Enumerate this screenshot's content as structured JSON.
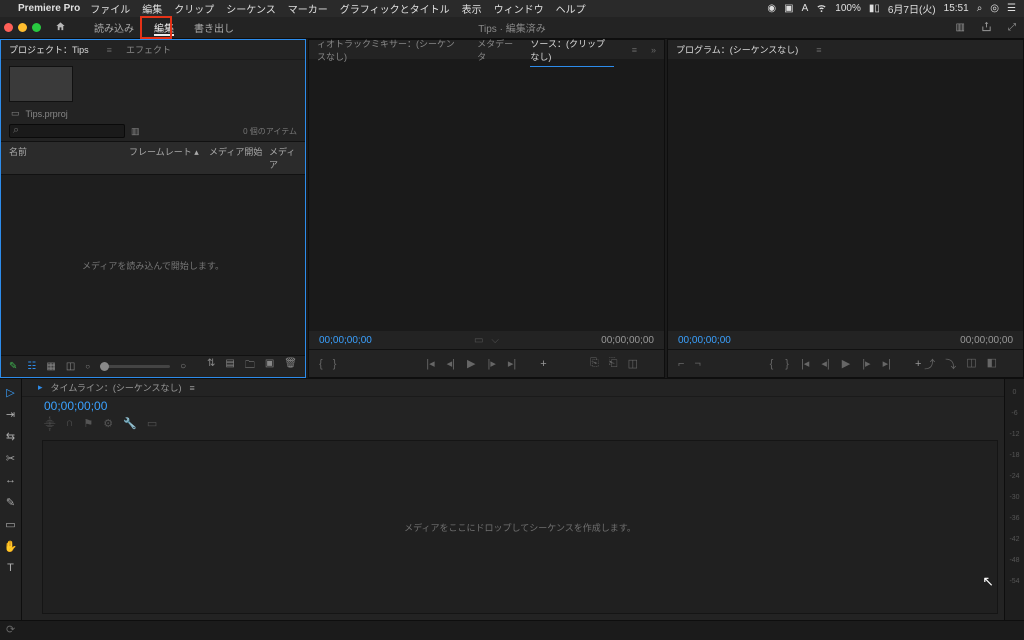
{
  "mac_menu": {
    "app": "Premiere Pro",
    "items": [
      "ファイル",
      "編集",
      "クリップ",
      "シーケンス",
      "マーカー",
      "グラフィックとタイトル",
      "表示",
      "ウィンドウ",
      "ヘルプ"
    ],
    "right": {
      "battery": "100%",
      "date": "6月7日(火)",
      "time": "15:51"
    }
  },
  "app_header": {
    "tabs": [
      "読み込み",
      "編集",
      "書き出し"
    ],
    "active_tab_index": 1,
    "title": "Tips · 編集済み"
  },
  "project_panel": {
    "tabs": [
      "プロジェクト：Tips",
      "エフェクト"
    ],
    "file": "Tips.prproj",
    "item_count": "0 個のアイテム",
    "columns": [
      "名前",
      "フレームレート ▴",
      "メディア開始",
      "メディア"
    ],
    "empty_msg": "メディアを読み込んで開始します。"
  },
  "source_panel": {
    "tabs_left": "ィオトラックミキサー：(シーケンスなし)",
    "tabs_mid": "メタデータ",
    "tabs_right": "ソース：(クリップなし)",
    "tc_left": "00;00;00;00",
    "tc_right": "00;00;00;00"
  },
  "program_panel": {
    "tab": "プログラム：(シーケンスなし)",
    "tc_left": "00;00;00;00",
    "tc_right": "00;00;00;00"
  },
  "timeline": {
    "tab": "タイムライン：(シーケンスなし)",
    "tc": "00;00;00;00",
    "empty_msg": "メディアをここにドロップしてシーケンスを作成します。"
  },
  "audio_meter": [
    "0",
    "-6",
    "-12",
    "-18",
    "-24",
    "-30",
    "-36",
    "-42",
    "-48",
    "-54"
  ]
}
